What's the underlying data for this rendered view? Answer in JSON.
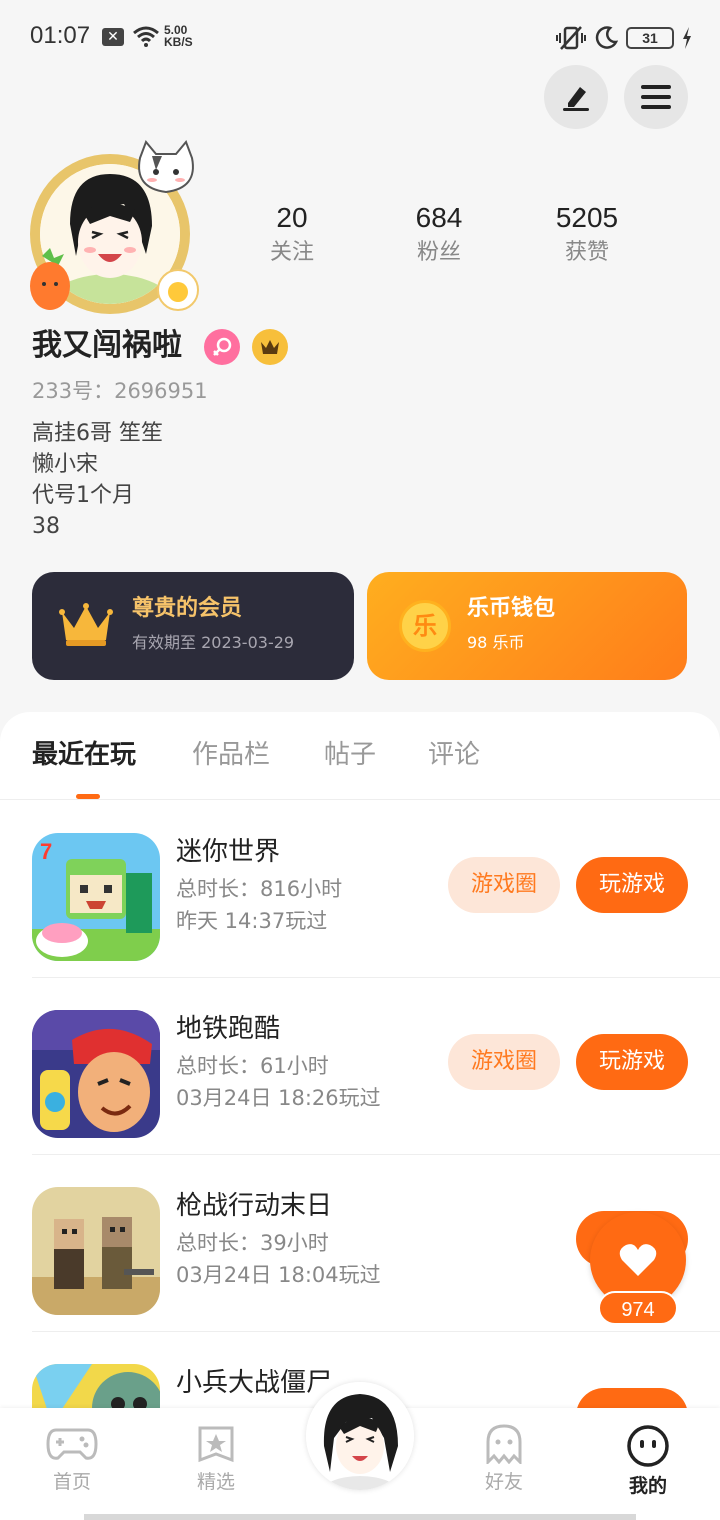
{
  "status_bar": {
    "time": "01:07",
    "net_speed_value": "5.00",
    "net_speed_unit": "KB/S",
    "battery": "31"
  },
  "profile": {
    "username": "我又闯祸啦",
    "uid": "233号：2696951",
    "bio_lines": [
      "高挂6哥  笙笙",
      "懒小宋",
      "代号1个月",
      "38"
    ],
    "stats": [
      {
        "value": "20",
        "label": "关注"
      },
      {
        "value": "684",
        "label": "粉丝"
      },
      {
        "value": "5205",
        "label": "获赞"
      }
    ]
  },
  "cards": {
    "member": {
      "title": "尊贵的会员",
      "subtitle": "有效期至  2023-03-29"
    },
    "wallet": {
      "icon_text": "乐",
      "title": "乐币钱包",
      "subtitle": "98  乐币"
    }
  },
  "tabs": [
    "最近在玩",
    "作品栏",
    "帖子",
    "评论"
  ],
  "games": [
    {
      "name": "迷你世界",
      "duration": "总时长：816小时",
      "last_played": "昨天  14:37玩过"
    },
    {
      "name": "地铁跑酷",
      "duration": "总时长：61小时",
      "last_played": "03月24日  18:26玩过"
    },
    {
      "name": "枪战行动末日",
      "duration": "总时长：39小时",
      "last_played": "03月24日  18:04玩过"
    },
    {
      "name": "小兵大战僵尸",
      "duration": "",
      "last_played": ""
    }
  ],
  "game_buttons": {
    "circle": "游戏圈",
    "play": "玩游戏"
  },
  "like_count": "974",
  "bottom_nav": [
    "首页",
    "精选",
    "好友",
    "我的"
  ],
  "colors": {
    "accent": "#ff6a13",
    "member_card": "#2c2c3a",
    "wallet_start": "#ffae1f",
    "wallet_end": "#ff7d1a"
  }
}
